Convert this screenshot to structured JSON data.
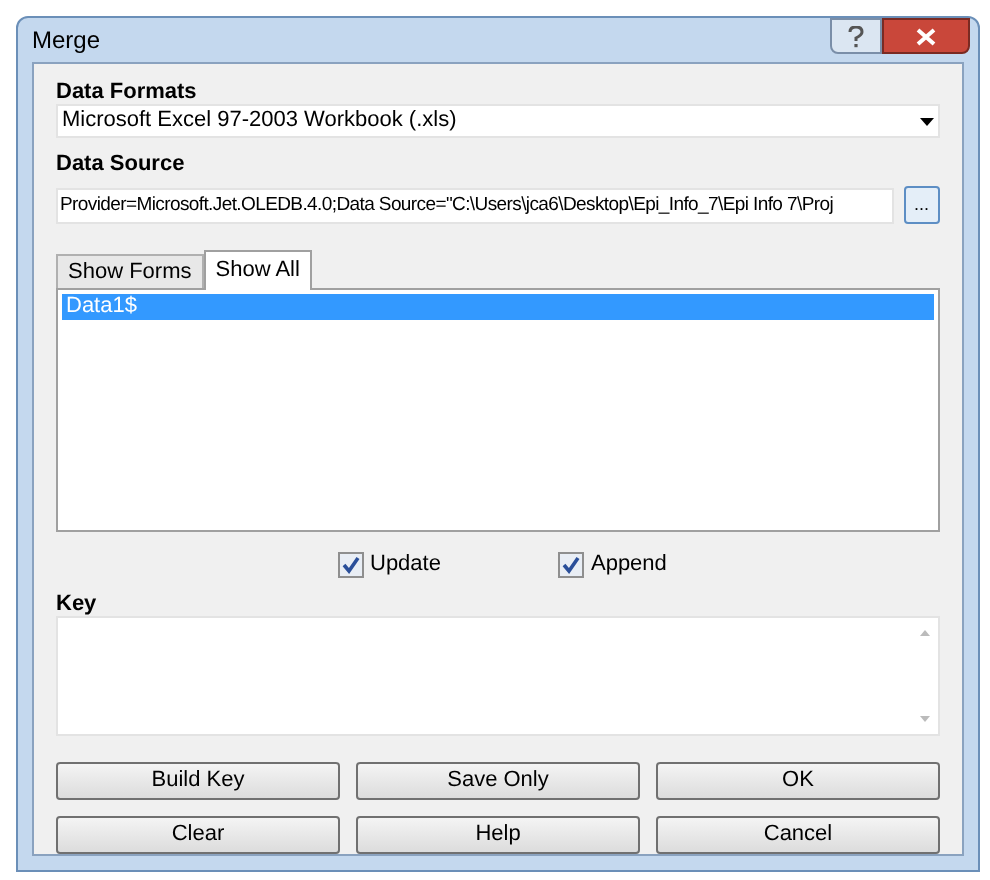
{
  "window": {
    "title": "Merge"
  },
  "data_formats": {
    "label": "Data Formats",
    "value": "Microsoft Excel 97-2003 Workbook (.xls)"
  },
  "data_source": {
    "label": "Data Source",
    "value": "Provider=Microsoft.Jet.OLEDB.4.0;Data Source=\"C:\\Users\\jca6\\Desktop\\Epi_Info_7\\Epi Info 7\\Proj",
    "browse": "..."
  },
  "tabs": [
    {
      "label": "Show Forms",
      "selected": false
    },
    {
      "label": "Show All",
      "selected": true
    }
  ],
  "list": [
    {
      "label": "Data1$",
      "selected": true
    }
  ],
  "options": [
    {
      "label": "Update",
      "checked": true
    },
    {
      "label": "Append",
      "checked": true
    }
  ],
  "key": {
    "label": "Key"
  },
  "buttons": [
    [
      "Build Key",
      "Save Only",
      "OK"
    ],
    [
      "Clear",
      "Help",
      "Cancel"
    ]
  ]
}
